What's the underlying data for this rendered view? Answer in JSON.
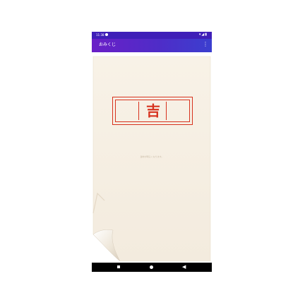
{
  "status_bar": {
    "time": "11:38",
    "icons": "▾◢▮"
  },
  "app_bar": {
    "title": "おみくじ",
    "menu_icon": "⋮"
  },
  "fortune": {
    "result": "吉",
    "message": "運命が明るくなります。"
  },
  "nav_bar": {
    "back_icon": "◀"
  },
  "colors": {
    "app_bar": "#4f2cc8",
    "stamp": "#d7321e",
    "paper": "#f6efe3"
  }
}
